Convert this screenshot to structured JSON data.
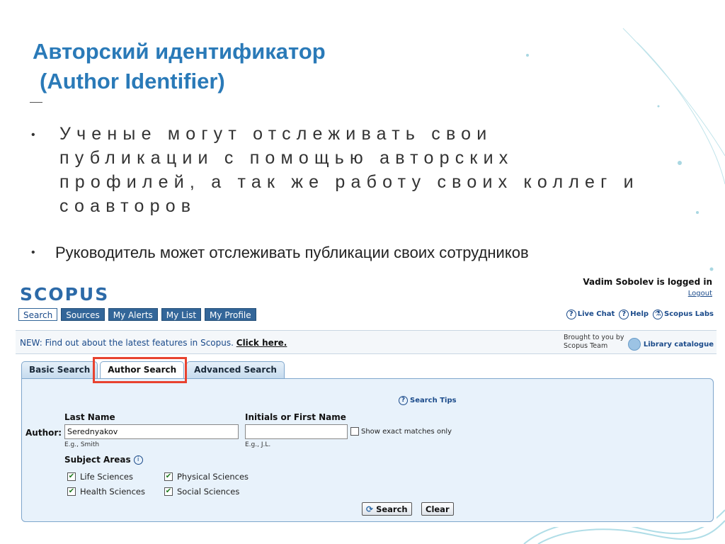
{
  "slide": {
    "title_line1": "Авторский идентификатор",
    "title_line2": "(Author Identifier)",
    "bullet1": "Ученые могут отслеживать свои публикации с помощью авторских профилей, а так же работу своих коллег и соавторов",
    "bullet2": "Руководитель может отслеживать публикации своих сотрудников",
    "bullet_glyph": "•"
  },
  "scopus": {
    "logo": "SCOPUS",
    "user": "Vadim Sobolev is logged in",
    "logout": "Logout",
    "nav": [
      "Search",
      "Sources",
      "My Alerts",
      "My List",
      "My Profile"
    ],
    "nav_active": "Search",
    "help_links": {
      "live_chat": "Live Chat",
      "help": "Help",
      "labs": "Scopus Labs"
    },
    "news": {
      "text": "NEW: Find out about the latest features in Scopus.",
      "link": "Click here."
    },
    "brought_line1": "Brought to you by",
    "brought_line2": "Scopus Team",
    "library": "Library catalogue",
    "search_tabs": [
      "Basic Search",
      "Author Search",
      "Advanced Search"
    ],
    "active_search_tab": "Author Search",
    "highlight_color": "#e8422f",
    "search_tips": "Search Tips",
    "last_name_label": "Last Name",
    "initials_label": "Initials or First Name",
    "author_label": "Author:",
    "last_name_value": "Serednyakov",
    "initials_value": "",
    "exact_matches": "Show exact matches only",
    "eg_last": "E.g., Smith",
    "eg_initials": "E.g., J.L.",
    "subject_areas_label": "Subject Areas",
    "subject_areas": [
      {
        "label": "Life Sciences",
        "checked": true
      },
      {
        "label": "Physical Sciences",
        "checked": true
      },
      {
        "label": "Health Sciences",
        "checked": true
      },
      {
        "label": "Social Sciences",
        "checked": true
      }
    ],
    "search_button": "Search",
    "clear_button": "Clear"
  },
  "colors": {
    "title": "#2a7ab8",
    "nav_bg": "#336699",
    "panel_bg": "#e8f2fb"
  }
}
